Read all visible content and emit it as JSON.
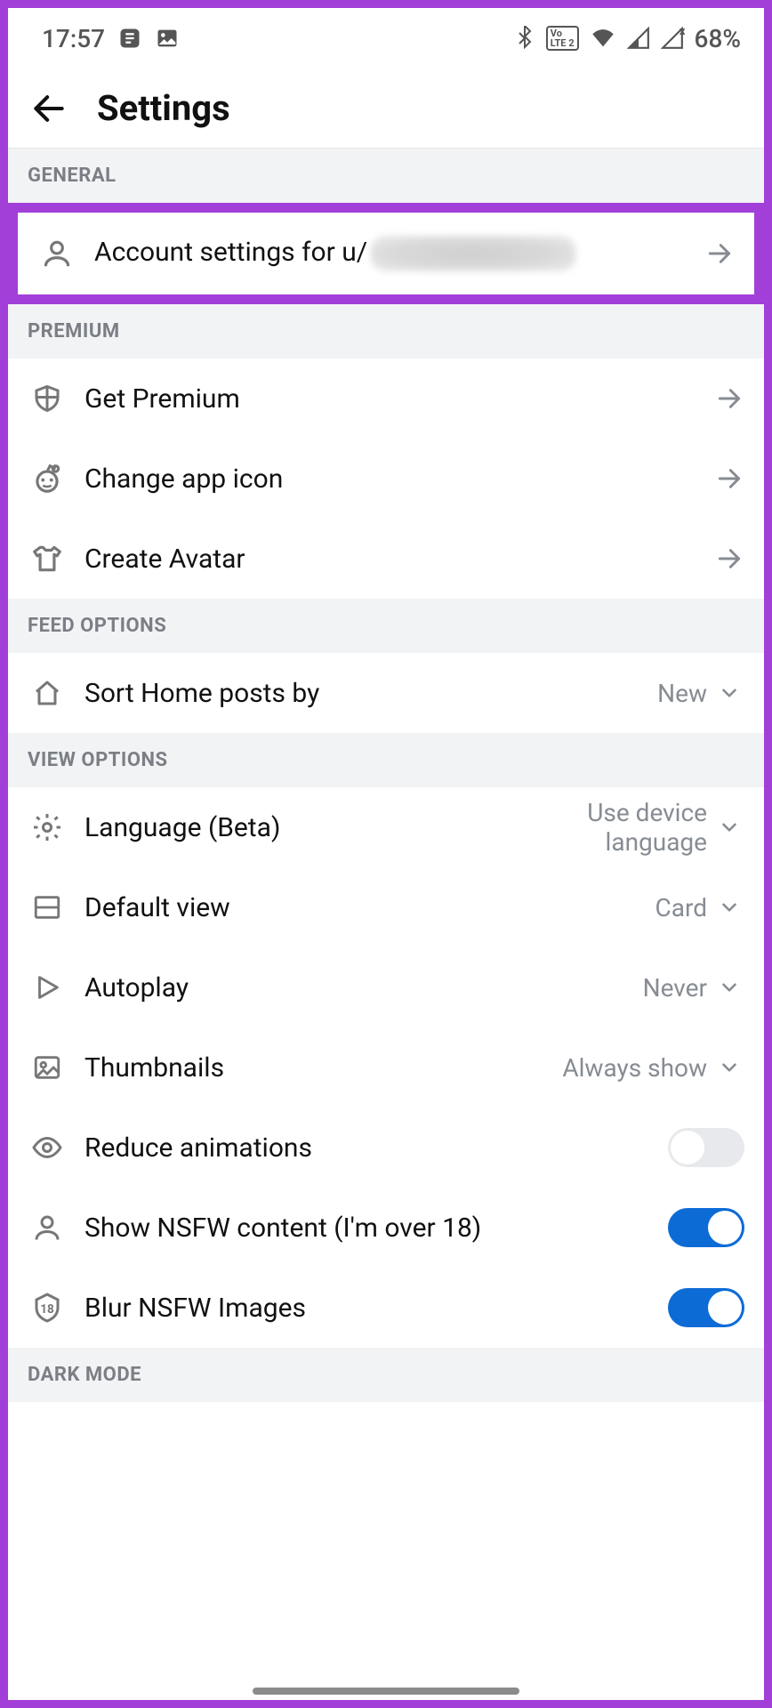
{
  "statusbar": {
    "time": "17:57",
    "battery": "68%",
    "lte_label": "LTE 2"
  },
  "appbar": {
    "title": "Settings"
  },
  "sections": {
    "general": "GENERAL",
    "premium": "PREMIUM",
    "feed": "FEED OPTIONS",
    "view": "VIEW OPTIONS",
    "dark": "DARK MODE"
  },
  "general": {
    "account_label_prefix": "Account settings for u/"
  },
  "premium": {
    "get": "Get Premium",
    "icon": "Change app icon",
    "avatar": "Create Avatar"
  },
  "feed": {
    "sort_label": "Sort Home posts by",
    "sort_value": "New"
  },
  "view": {
    "language_label": "Language (Beta)",
    "language_value": "Use device language",
    "default_view_label": "Default view",
    "default_view_value": "Card",
    "autoplay_label": "Autoplay",
    "autoplay_value": "Never",
    "thumbnails_label": "Thumbnails",
    "thumbnails_value": "Always show",
    "reduce_label": "Reduce animations",
    "reduce_on": false,
    "nsfw_label": "Show NSFW content (I'm over 18)",
    "nsfw_on": true,
    "blur_label": "Blur NSFW Images",
    "blur_on": true
  }
}
